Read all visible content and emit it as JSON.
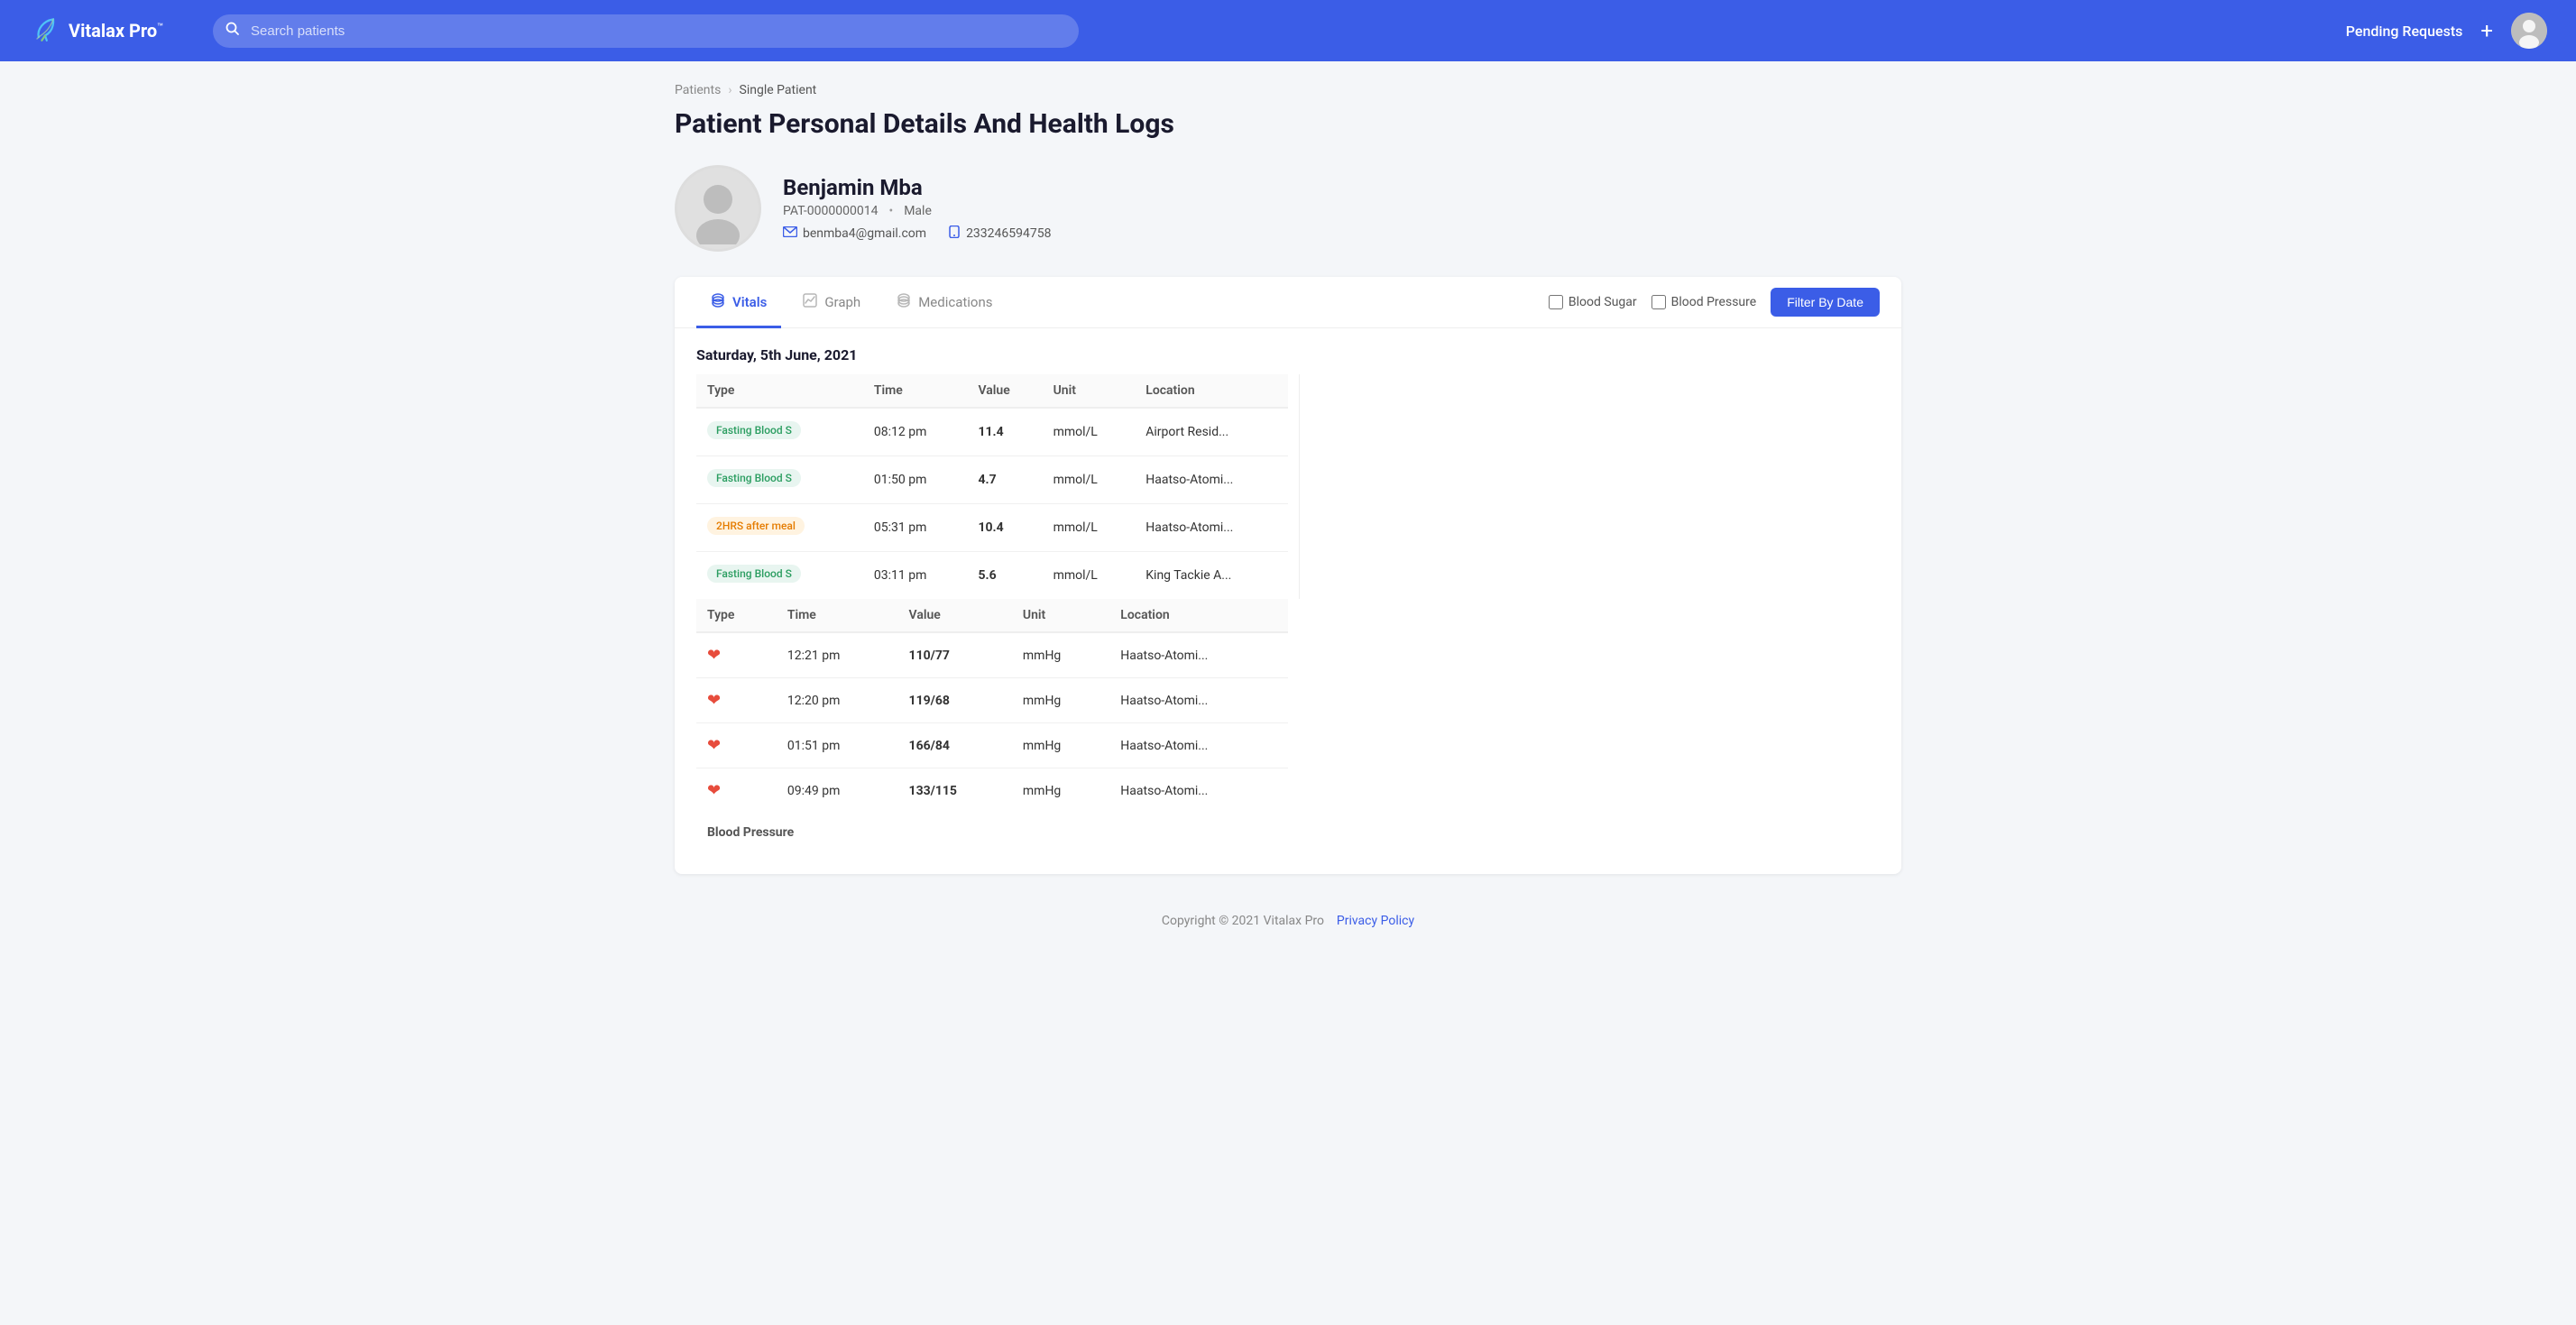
{
  "app": {
    "name": "Vitalax Pro",
    "tm": "™"
  },
  "header": {
    "search_placeholder": "Search patients",
    "pending_requests": "Pending Requests",
    "add_btn": "+",
    "logo_alt": "Vitalax Pro Logo"
  },
  "breadcrumb": {
    "parent": "Patients",
    "separator": "›",
    "current": "Single Patient"
  },
  "page": {
    "title": "Patient Personal Details And Health Logs"
  },
  "patient": {
    "name": "Benjamin Mba",
    "id": "PAT-0000000014",
    "gender": "Male",
    "email": "benmba4@gmail.com",
    "phone": "233246594758"
  },
  "tabs": {
    "items": [
      {
        "id": "vitals",
        "label": "Vitals",
        "active": true
      },
      {
        "id": "graph",
        "label": "Graph",
        "active": false
      },
      {
        "id": "medications",
        "label": "Medications",
        "active": false
      }
    ],
    "filter_blood_sugar": "Blood Sugar",
    "filter_blood_pressure": "Blood Pressure",
    "filter_btn": "Filter By Date"
  },
  "date_heading": "Saturday, 5th June, 2021",
  "table_left": {
    "columns": [
      "Type",
      "Time",
      "Value",
      "Unit",
      "Location"
    ],
    "rows": [
      {
        "type": "Fasting Blood S",
        "type_variant": "fasting",
        "time": "08:12 pm",
        "value": "11.4",
        "unit": "mmol/L",
        "location": "Airport Resid..."
      },
      {
        "type": "Fasting Blood S",
        "type_variant": "fasting",
        "time": "01:50 pm",
        "value": "4.7",
        "unit": "mmol/L",
        "location": "Haatso-Atomi..."
      },
      {
        "type": "2HRS after meal",
        "type_variant": "meal",
        "time": "05:31 pm",
        "value": "10.4",
        "unit": "mmol/L",
        "location": "Haatso-Atomi..."
      },
      {
        "type": "Fasting Blood S",
        "type_variant": "fasting",
        "time": "03:11 pm",
        "value": "5.6",
        "unit": "mmol/L",
        "location": "King Tackie A..."
      }
    ]
  },
  "table_right": {
    "columns": [
      "Type",
      "Time",
      "Value",
      "Unit",
      "Location"
    ],
    "rows": [
      {
        "type": "heart",
        "time": "12:21 pm",
        "value": "110/77",
        "unit": "mmHg",
        "location": "Haatso-Atomi..."
      },
      {
        "type": "heart",
        "time": "12:20 pm",
        "value": "119/68",
        "unit": "mmHg",
        "location": "Haatso-Atomi..."
      },
      {
        "type": "heart",
        "time": "01:51 pm",
        "value": "166/84",
        "unit": "mmHg",
        "location": "Haatso-Atomi..."
      },
      {
        "type": "heart",
        "time": "09:49 pm",
        "value": "133/115",
        "unit": "mmHg",
        "location": "Haatso-Atomi..."
      }
    ],
    "bp_label": "Blood Pressure"
  },
  "footer": {
    "copy": "Copyright © 2021 Vitalax Pro",
    "privacy_link": "Privacy Policy"
  }
}
